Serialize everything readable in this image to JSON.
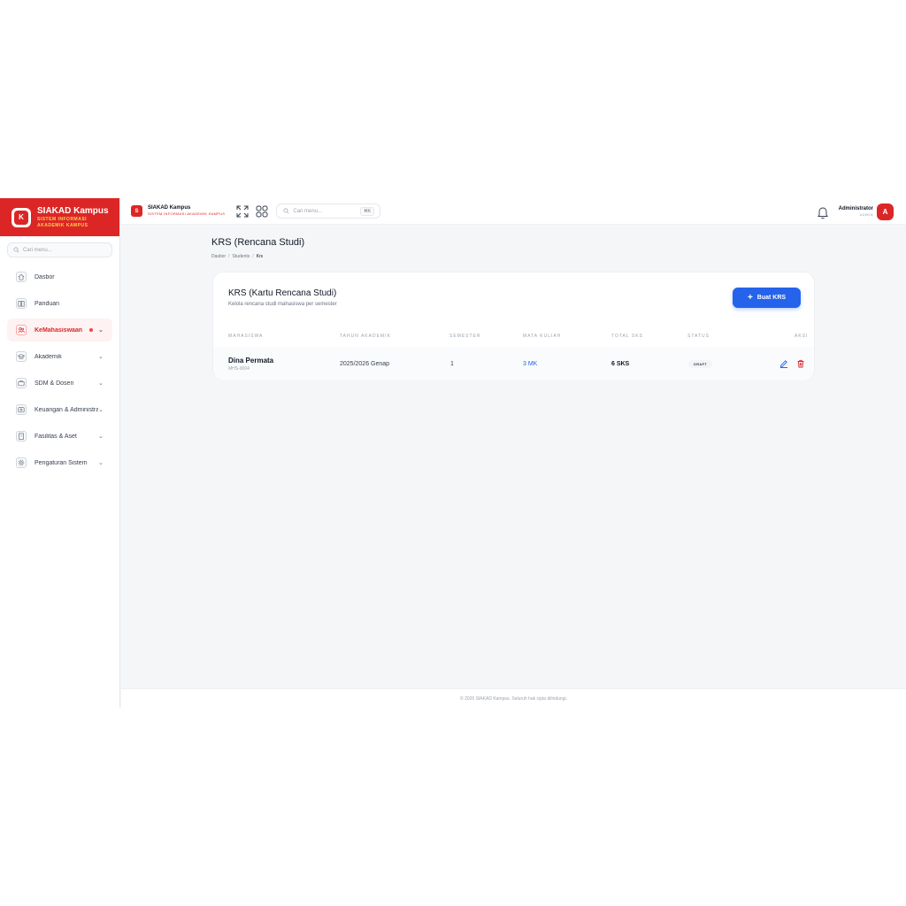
{
  "sidebar": {
    "brand_logo": "K",
    "brand_title": "SIAKAD Kampus",
    "brand_sub_1": "SISTEM INFORMASI",
    "brand_sub_2": "AKADEMIK KAMPUS",
    "search_placeholder": "Cari menu...",
    "items": [
      {
        "label": "Dasbor",
        "icon": "home-icon"
      },
      {
        "label": "Panduan",
        "icon": "book-icon"
      },
      {
        "label": "KeMahasiswaan",
        "icon": "users-icon",
        "active": true
      },
      {
        "label": "Akademik",
        "icon": "graduation-cap-icon"
      },
      {
        "label": "SDM & Dosen",
        "icon": "briefcase-icon"
      },
      {
        "label": "Keuangan & Administrasi",
        "icon": "wallet-icon"
      },
      {
        "label": "Fasilitas & Aset",
        "icon": "building-icon"
      },
      {
        "label": "Pengaturan Sistem",
        "icon": "gear-icon"
      }
    ]
  },
  "topbar": {
    "logo": "S",
    "title": "SIAKAD Kampus",
    "subtitle": "SISTEM INFORMASI AKADEMIK KAMPUS",
    "search_placeholder": "Cari menu...",
    "shortcut": "⌘K",
    "user_name": "Administrator",
    "user_role": "ADMIN",
    "avatar": "A"
  },
  "page": {
    "title": "KRS (Rencana Studi)",
    "breadcrumb": [
      "Dasbor",
      "Students",
      "Krs"
    ]
  },
  "card": {
    "title": "KRS (Kartu Rencana Studi)",
    "subtitle": "Kelola rencana studi mahasiswa per semester",
    "button_label": "Buat KRS",
    "columns": [
      "MAHASISWA",
      "TAHUN AKADEMIK",
      "SEMESTER",
      "MATA KULIAH",
      "TOTAL SKS",
      "STATUS",
      "AKSI"
    ],
    "rows": [
      {
        "name": "Dina Permata",
        "nim": "MHS-0004",
        "tahun": "2025/2026 Genap",
        "semester": "1",
        "mata_kuliah": "3 MK",
        "total_sks": "6 SKS",
        "status": "DRAFT"
      }
    ]
  },
  "footer": "© 2026 SIAKAD Kampus. Seluruh hak cipta dilindungi.",
  "colors": {
    "brand": "#dc2626",
    "primary": "#2563eb",
    "edit_icon": "#2563eb",
    "delete_icon": "#dc2626"
  }
}
